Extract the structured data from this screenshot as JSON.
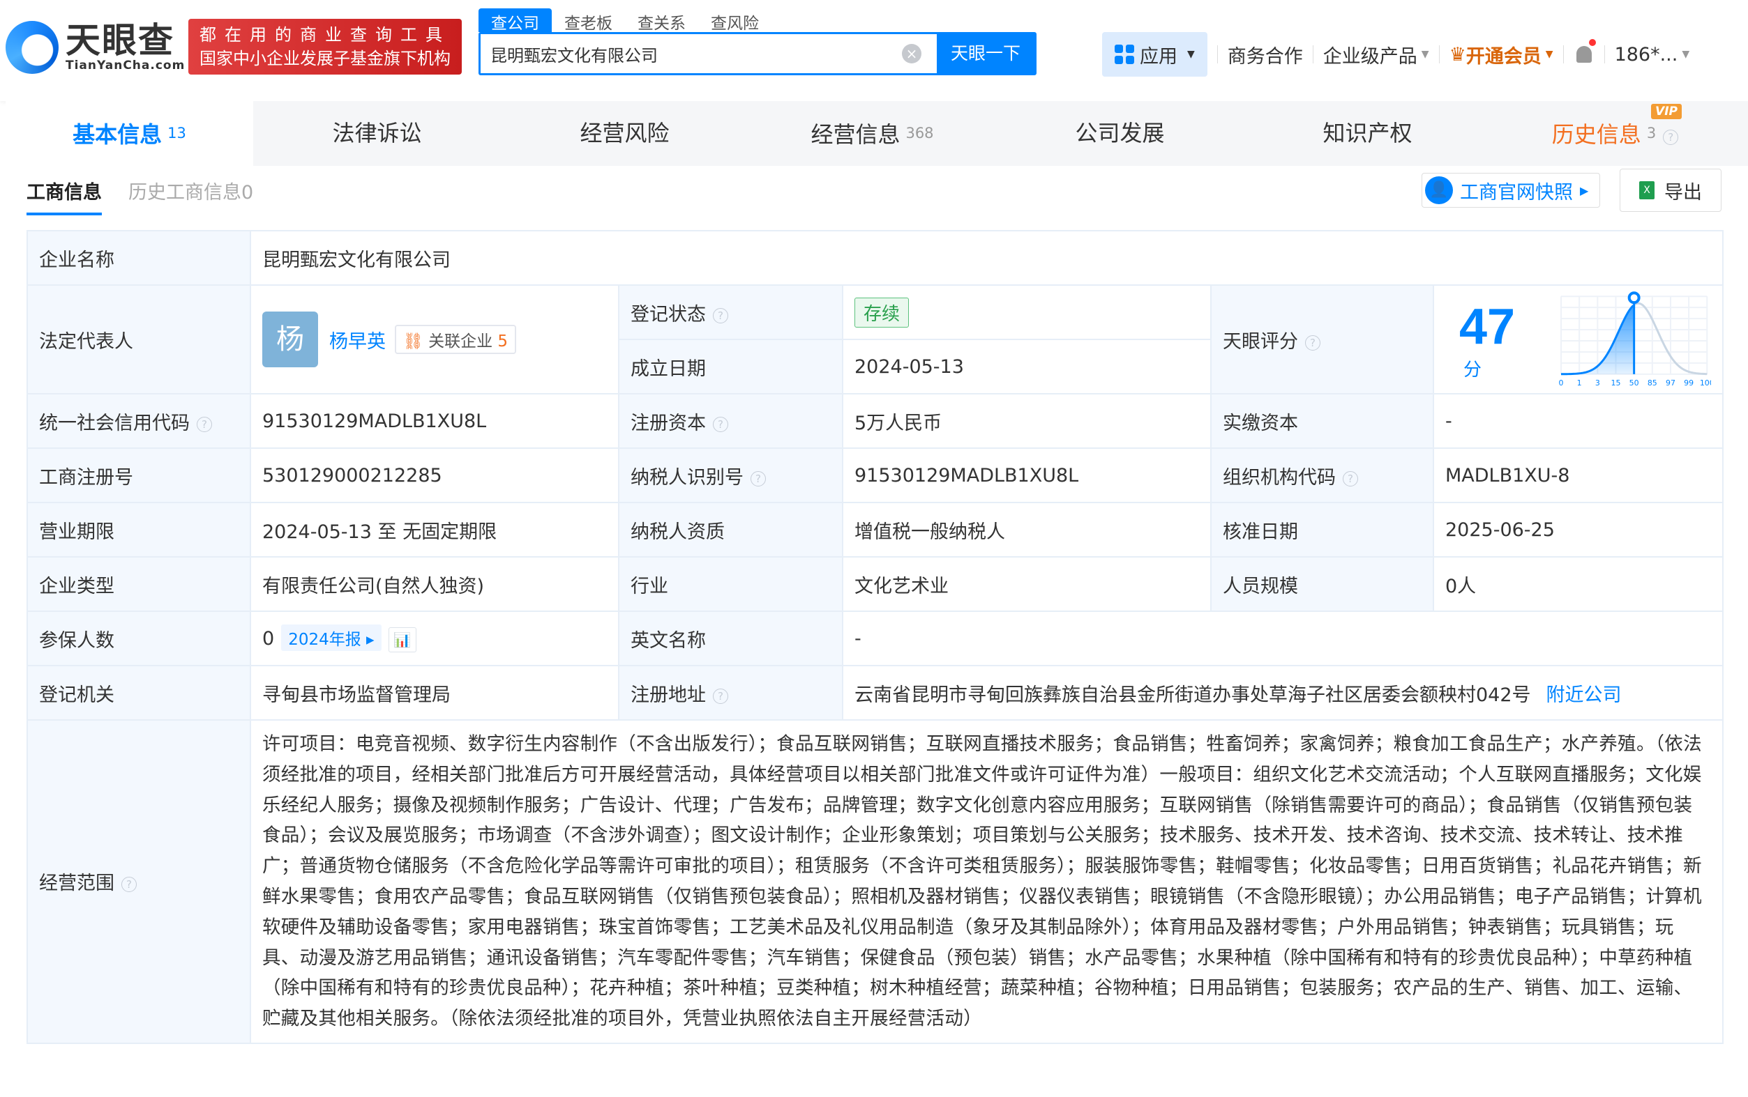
{
  "header": {
    "logo_cn": "天眼查",
    "logo_en": "TianYanCha.com",
    "banner_line1": "都在用的商业查询工具",
    "banner_line2": "国家中小企业发展子基金旗下机构",
    "search_tabs": [
      "查公司",
      "查老板",
      "查关系",
      "查风险"
    ],
    "search_value": "昆明甄宏文化有限公司",
    "search_button": "天眼一下",
    "nav": {
      "apps": "应用",
      "business": "商务合作",
      "enterprise": "企业级产品",
      "vip": "开通会员",
      "user": "186*..."
    }
  },
  "tabs": [
    {
      "label": "基本信息",
      "count": "13"
    },
    {
      "label": "法律诉讼",
      "count": ""
    },
    {
      "label": "经营风险",
      "count": ""
    },
    {
      "label": "经营信息",
      "count": "368"
    },
    {
      "label": "公司发展",
      "count": ""
    },
    {
      "label": "知识产权",
      "count": ""
    },
    {
      "label": "历史信息",
      "count": "3",
      "tag": "VIP"
    }
  ],
  "subtabs": {
    "active": "工商信息",
    "other": "历史工商信息0",
    "snapshot": "工商官网快照",
    "export": "导出"
  },
  "info": {
    "name_label": "企业名称",
    "name": "昆明甄宏文化有限公司",
    "rep_label": "法定代表人",
    "rep_avatar": "杨",
    "rep_name": "杨早英",
    "rep_related": "关联企业",
    "rep_related_count": "5",
    "status_label": "登记状态",
    "status": "存续",
    "founded_label": "成立日期",
    "founded": "2024-05-13",
    "score_label": "天眼评分",
    "score": "47",
    "score_unit": "分",
    "credit_label": "统一社会信用代码",
    "credit": "91530129MADLB1XU8L",
    "capital_label": "注册资本",
    "capital": "5万人民币",
    "paid_label": "实缴资本",
    "paid": "-",
    "regno_label": "工商注册号",
    "regno": "530129000212285",
    "taxid_label": "纳税人识别号",
    "taxid": "91530129MADLB1XU8L",
    "org_label": "组织机构代码",
    "org": "MADLB1XU-8",
    "term_label": "营业期限",
    "term": "2024-05-13 至 无固定期限",
    "taxq_label": "纳税人资质",
    "taxq": "增值税一般纳税人",
    "approve_label": "核准日期",
    "approve": "2025-06-25",
    "type_label": "企业类型",
    "type": "有限责任公司(自然人独资)",
    "industry_label": "行业",
    "industry": "文化艺术业",
    "staff_label": "人员规模",
    "staff": "0人",
    "insured_label": "参保人数",
    "insured": "0",
    "insured_year": "2024年报",
    "en_label": "英文名称",
    "en": "-",
    "authority_label": "登记机关",
    "authority": "寻甸县市场监督管理局",
    "addr_label": "注册地址",
    "addr": "云南省昆明市寻甸回族彝族自治县金所街道办事处草海子社区居委会额秧村042号",
    "nearby": "附近公司",
    "scope_label": "经营范围",
    "scope": "许可项目：电竞音视频、数字衍生内容制作（不含出版发行）；食品互联网销售；互联网直播技术服务；食品销售；牲畜饲养；家禽饲养；粮食加工食品生产；水产养殖。（依法须经批准的项目，经相关部门批准后方可开展经营活动，具体经营项目以相关部门批准文件或许可证件为准）一般项目：组织文化艺术交流活动；个人互联网直播服务；文化娱乐经纪人服务；摄像及视频制作服务；广告设计、代理；广告发布；品牌管理；数字文化创意内容应用服务；互联网销售（除销售需要许可的商品）；食品销售（仅销售预包装食品）；会议及展览服务；市场调查（不含涉外调查）；图文设计制作；企业形象策划；项目策划与公关服务；技术服务、技术开发、技术咨询、技术交流、技术转让、技术推广；普通货物仓储服务（不含危险化学品等需许可审批的项目）；租赁服务（不含许可类租赁服务）；服装服饰零售；鞋帽零售；化妆品零售；日用百货销售；礼品花卉销售；新鲜水果零售；食用农产品零售；食品互联网销售（仅销售预包装食品）；照相机及器材销售；仪器仪表销售；眼镜销售（不含隐形眼镜）；办公用品销售；电子产品销售；计算机软硬件及辅助设备零售；家用电器销售；珠宝首饰零售；工艺美术品及礼仪用品制造（象牙及其制品除外）；体育用品及器材零售；户外用品销售；钟表销售；玩具销售；玩具、动漫及游艺用品销售；通讯设备销售；汽车零配件零售；汽车销售；保健食品（预包装）销售；水产品零售；水果种植（除中国稀有和特有的珍贵优良品种）；中草药种植（除中国稀有和特有的珍贵优良品种）；花卉种植；茶叶种植；豆类种植；树木种植经营；蔬菜种植；谷物种植；日用品销售；包装服务；农产品的生产、销售、加工、运输、贮藏及其他相关服务。（除依法须经批准的项目外，凭营业执照依法自主开展经营活动）"
  },
  "chart_data": {
    "type": "area",
    "title": "天眼评分分布",
    "x_ticks": [
      "0",
      "1",
      "3",
      "15",
      "50",
      "85",
      "97",
      "99",
      "100"
    ],
    "marker_percentile": "50",
    "score": 47,
    "colors": {
      "fill": "#0084ff",
      "rest": "#c9d6e3"
    }
  }
}
